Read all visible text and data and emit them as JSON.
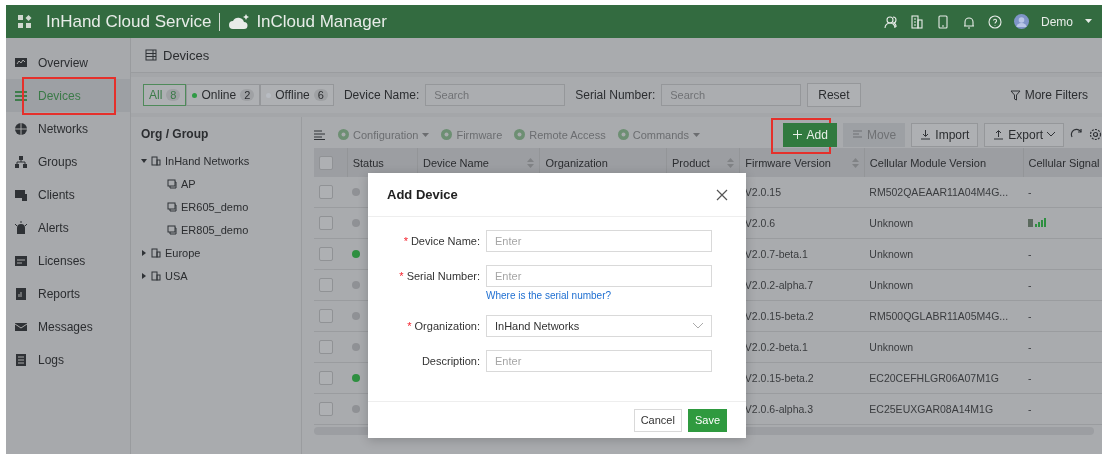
{
  "header": {
    "brand": "InHand Cloud Service",
    "product": "InCloud Manager",
    "user": "Demo"
  },
  "sidebar": {
    "items": [
      {
        "label": "Overview",
        "selected": false,
        "highlighted": false
      },
      {
        "label": "Devices",
        "selected": true,
        "highlighted": true
      },
      {
        "label": "Networks",
        "selected": false,
        "highlighted": false
      },
      {
        "label": "Groups",
        "selected": false,
        "highlighted": false
      },
      {
        "label": "Clients",
        "selected": false,
        "highlighted": false
      },
      {
        "label": "Alerts",
        "selected": false,
        "highlighted": false
      },
      {
        "label": "Licenses",
        "selected": false,
        "highlighted": false
      },
      {
        "label": "Reports",
        "selected": false,
        "highlighted": false
      },
      {
        "label": "Messages",
        "selected": false,
        "highlighted": false
      },
      {
        "label": "Logs",
        "selected": false,
        "highlighted": false
      }
    ]
  },
  "page_title": "Devices",
  "filters": {
    "segments": [
      {
        "label": "All",
        "count": "8",
        "selected": true
      },
      {
        "label": "Online",
        "count": "2",
        "selected": false,
        "color": "#2f9a45"
      },
      {
        "label": "Offline",
        "count": "6",
        "selected": false,
        "color": "#b8bcc2"
      }
    ],
    "fields": [
      {
        "label": "Device Name:",
        "placeholder": "Search"
      },
      {
        "label": "Serial Number:",
        "placeholder": "Search"
      }
    ],
    "reset": "Reset",
    "more": "More Filters"
  },
  "org_panel": {
    "title": "Org / Group",
    "tree": [
      {
        "label": "InHand Networks",
        "kind": "org",
        "expanded": true,
        "children": [
          {
            "label": "AP",
            "kind": "group"
          },
          {
            "label": "ER605_demo",
            "kind": "group"
          },
          {
            "label": "ER805_demo",
            "kind": "group"
          }
        ]
      },
      {
        "label": "Europe",
        "kind": "org",
        "expanded": false
      },
      {
        "label": "USA",
        "kind": "org",
        "expanded": false
      }
    ]
  },
  "toolbar": {
    "actions": [
      {
        "label": "Configuration",
        "dropdown": true
      },
      {
        "label": "Firmware",
        "dropdown": false
      },
      {
        "label": "Remote Access",
        "dropdown": false
      },
      {
        "label": "Commands",
        "dropdown": true
      }
    ],
    "buttons": [
      {
        "label": "Add",
        "kind": "primary",
        "disabled": false,
        "highlighted": true
      },
      {
        "label": "Move",
        "kind": "move",
        "disabled": true,
        "highlighted": false
      },
      {
        "label": "Import",
        "kind": "import",
        "disabled": false,
        "highlighted": false
      },
      {
        "label": "Export",
        "kind": "export",
        "disabled": false,
        "highlighted": false
      }
    ]
  },
  "table": {
    "select_all_checked": false,
    "columns": [
      {
        "label": "Status",
        "sortable": false
      },
      {
        "label": "Device Name",
        "sortable": true
      },
      {
        "label": "Organization",
        "sortable": false
      },
      {
        "label": "Product",
        "sortable": true
      },
      {
        "label": "Firmware Version",
        "sortable": true
      },
      {
        "label": "Cellular Module Version",
        "sortable": false
      },
      {
        "label": "Cellular Signal",
        "sortable": false
      }
    ],
    "rows": [
      {
        "checked": false,
        "online": false,
        "firmware": "V2.0.15",
        "module": "RM502QAEAAR11A04M4G...",
        "signal": {
          "kind": "text",
          "text": "-"
        }
      },
      {
        "checked": false,
        "online": false,
        "firmware": "V2.0.6",
        "module": "Unknown",
        "signal": {
          "kind": "bars"
        }
      },
      {
        "checked": false,
        "online": true,
        "firmware": "V2.0.7-beta.1",
        "module": "Unknown",
        "signal": {
          "kind": "text",
          "text": "-"
        }
      },
      {
        "checked": false,
        "online": false,
        "firmware": "V2.0.2-alpha.7",
        "module": "Unknown",
        "signal": {
          "kind": "text",
          "text": "-"
        }
      },
      {
        "checked": false,
        "online": false,
        "firmware": "V2.0.15-beta.2",
        "module": "RM500QGLABR11A05M4G...",
        "signal": {
          "kind": "text",
          "text": "-"
        }
      },
      {
        "checked": false,
        "online": false,
        "firmware": "V2.0.2-beta.1",
        "module": "Unknown",
        "signal": {
          "kind": "text",
          "text": "-"
        }
      },
      {
        "checked": false,
        "online": true,
        "firmware": "V2.0.15-beta.2",
        "module": "EC20CEFHLGR06A07M1G",
        "signal": {
          "kind": "text",
          "text": "-"
        }
      },
      {
        "checked": false,
        "online": false,
        "firmware": "V2.0.6-alpha.3",
        "module": "EC25EUXGAR08A14M1G",
        "signal": {
          "kind": "text",
          "text": "-"
        }
      }
    ]
  },
  "modal": {
    "title": "Add Device",
    "fields": [
      {
        "label": "Device Name:",
        "kind": "input",
        "required_mark": "*",
        "placeholder": "Enter"
      },
      {
        "label": "Serial Number:",
        "kind": "input",
        "required_mark": "*",
        "placeholder": "Enter",
        "help_link": "Where is the serial number?"
      },
      {
        "label": "Organization:",
        "kind": "select",
        "required_mark": "*",
        "value": "InHand Networks"
      },
      {
        "label": "Description:",
        "kind": "input",
        "placeholder": "Enter"
      }
    ],
    "cancel": "Cancel",
    "save": "Save"
  }
}
